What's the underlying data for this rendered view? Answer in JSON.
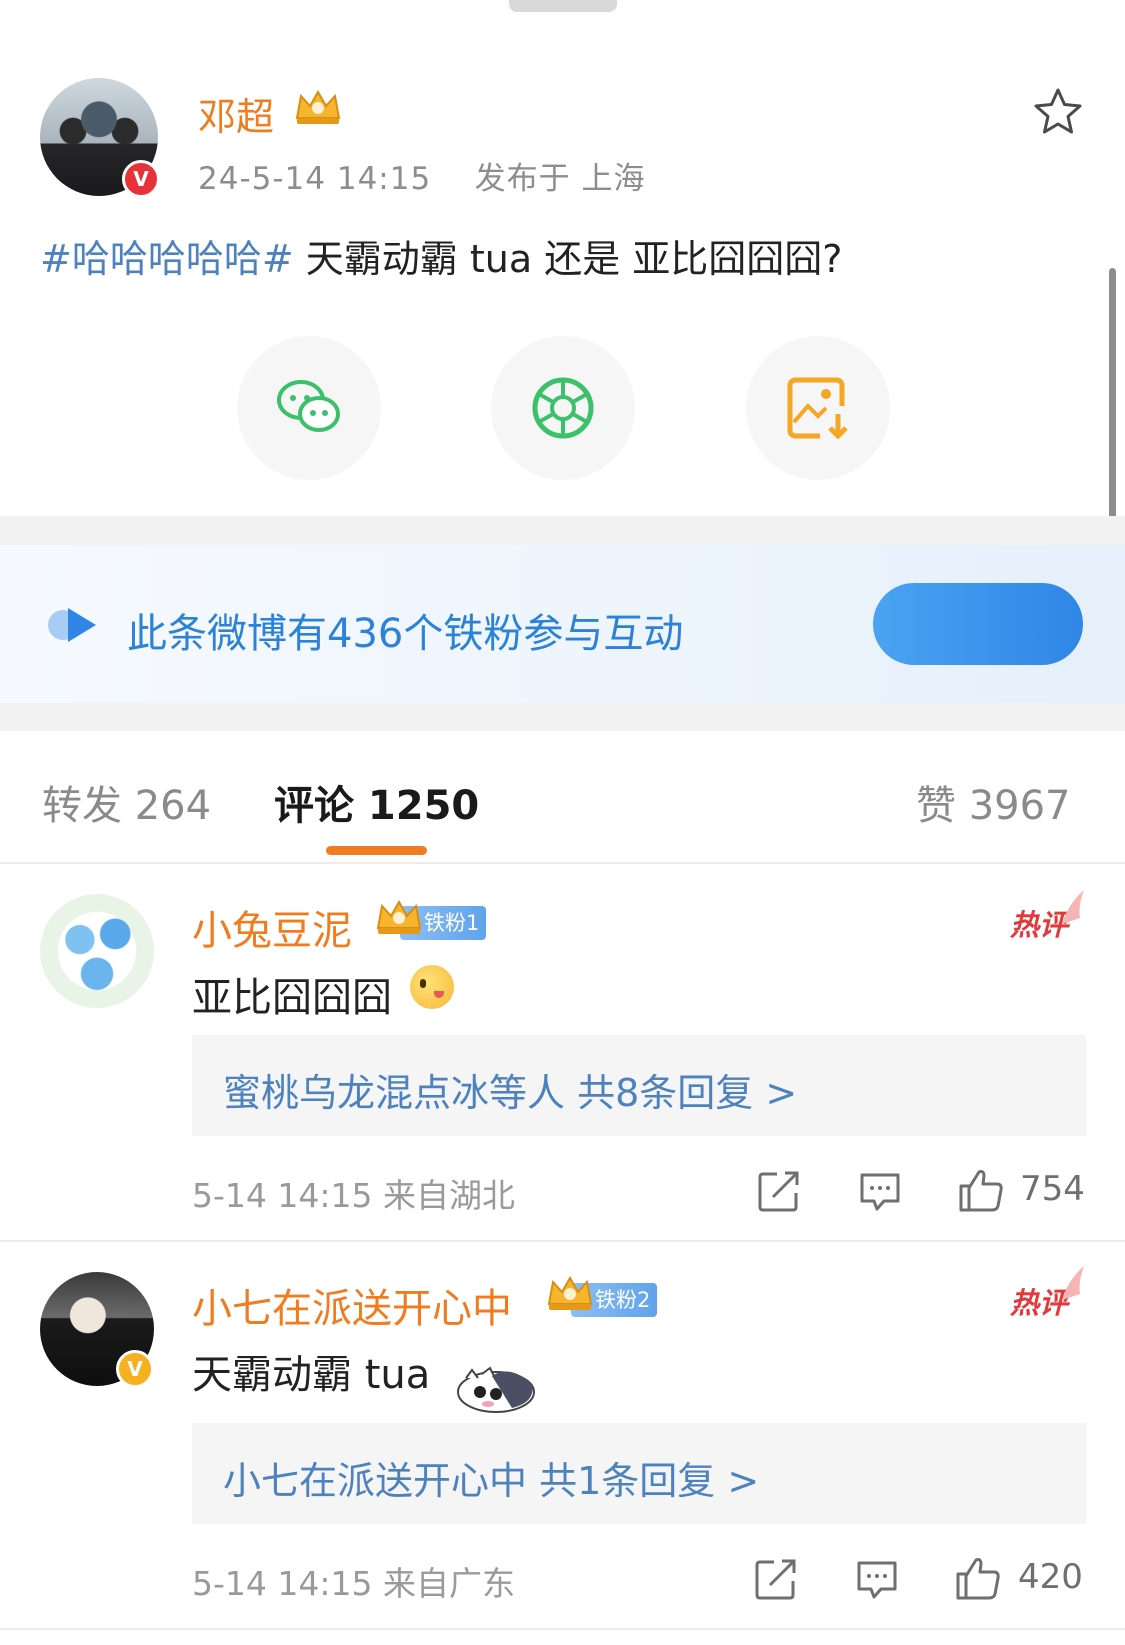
{
  "post": {
    "author": "邓超",
    "timestamp": "24-5-14 14:15",
    "location_label": "发布于 上海",
    "topic": "#哈哈哈哈哈#",
    "text": " 天霸动霸 tua 还是 亚比囧囧囧?"
  },
  "share_buttons": [
    {
      "icon": "wechat-icon"
    },
    {
      "icon": "moments-icon"
    },
    {
      "icon": "save-image-icon"
    }
  ],
  "fans_banner": {
    "text": "此条微博有436个铁粉参与互动"
  },
  "tabs": {
    "repost": "转发 264",
    "comment": "评论 1250",
    "like": "赞 3967"
  },
  "comments": [
    {
      "author": "小兔豆泥",
      "fan_badge": "铁粉1",
      "hot_label": "热评",
      "text": "亚比囧囧囧",
      "reply_summary": "蜜桃乌龙混点冰等人  共8条回复 >",
      "meta": "5-14 14:15  来自湖北",
      "like_count": "754"
    },
    {
      "author": "小七在派送开心中",
      "fan_badge": "铁粉2",
      "hot_label": "热评",
      "text": "天霸动霸 tua",
      "reply_summary": "小七在派送开心中  共1条回复 >",
      "meta": "5-14 14:15  来自广东",
      "like_count": "420"
    }
  ],
  "colors": {
    "accent_orange": "#f07c1f",
    "link_blue": "#4d82be",
    "banner_blue": "#2b82d8",
    "hot_red": "#e4393c"
  }
}
